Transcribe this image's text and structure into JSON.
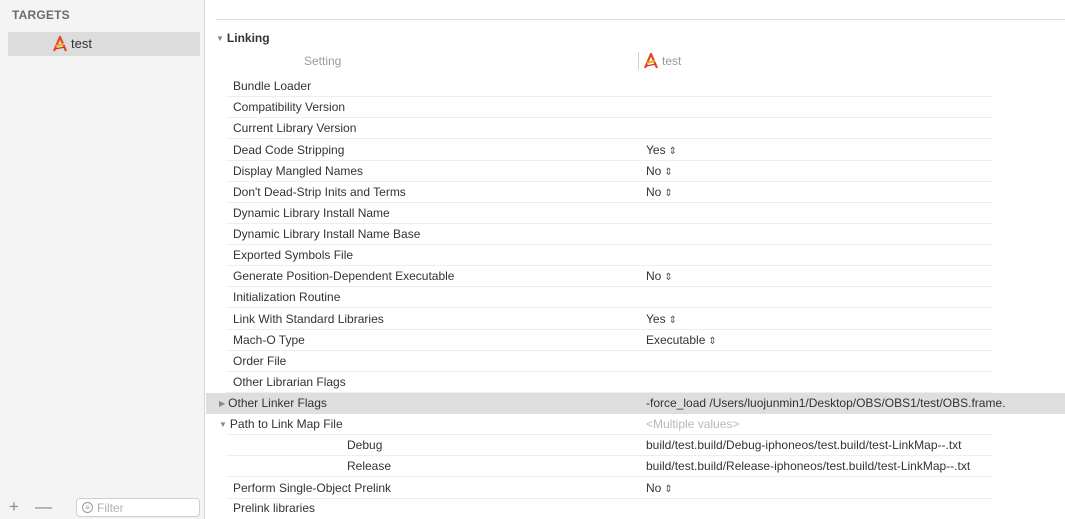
{
  "sidebar": {
    "header": "TARGETS",
    "target": {
      "label": "test",
      "icon": "app-target-icon"
    },
    "bottom": {
      "add": "+",
      "remove": "—",
      "filter_placeholder": "Filter"
    }
  },
  "settings": {
    "section_title": "Linking",
    "columns": {
      "setting": "Setting",
      "target": "test"
    },
    "rows": [
      {
        "label": "Bundle Loader",
        "value": ""
      },
      {
        "label": "Compatibility Version",
        "value": ""
      },
      {
        "label": "Current Library Version",
        "value": ""
      },
      {
        "label": "Dead Code Stripping",
        "value": "Yes"
      },
      {
        "label": "Display Mangled Names",
        "value": "No"
      },
      {
        "label": "Don't Dead-Strip Inits and Terms",
        "value": "No"
      },
      {
        "label": "Dynamic Library Install Name",
        "value": ""
      },
      {
        "label": "Dynamic Library Install Name Base",
        "value": ""
      },
      {
        "label": "Exported Symbols File",
        "value": ""
      },
      {
        "label": "Generate Position-Dependent Executable",
        "value": "No"
      },
      {
        "label": "Initialization Routine",
        "value": ""
      },
      {
        "label": "Link With Standard Libraries",
        "value": "Yes"
      },
      {
        "label": "Mach-O Type",
        "value": "Executable"
      },
      {
        "label": "Order File",
        "value": ""
      },
      {
        "label": "Other Librarian Flags",
        "value": ""
      },
      {
        "label": "Other Linker Flags",
        "value": "-force_load /Users/luojunmin1/Desktop/OBS/OBS1/test/OBS.frame."
      },
      {
        "label": "Path to Link Map File",
        "value": "<Multiple values>"
      },
      {
        "label": "Debug",
        "value": "build/test.build/Debug-iphoneos/test.build/test-LinkMap--.txt"
      },
      {
        "label": "Release",
        "value": "build/test.build/Release-iphoneos/test.build/test-LinkMap--.txt"
      },
      {
        "label": "Perform Single-Object Prelink",
        "value": "No"
      },
      {
        "label": "Prelink libraries",
        "value": ""
      }
    ]
  },
  "colors": {
    "sidebar_bg": "#f4f4f4",
    "selected_bg": "#dcdcdc",
    "highlight_row": "#dedede"
  }
}
